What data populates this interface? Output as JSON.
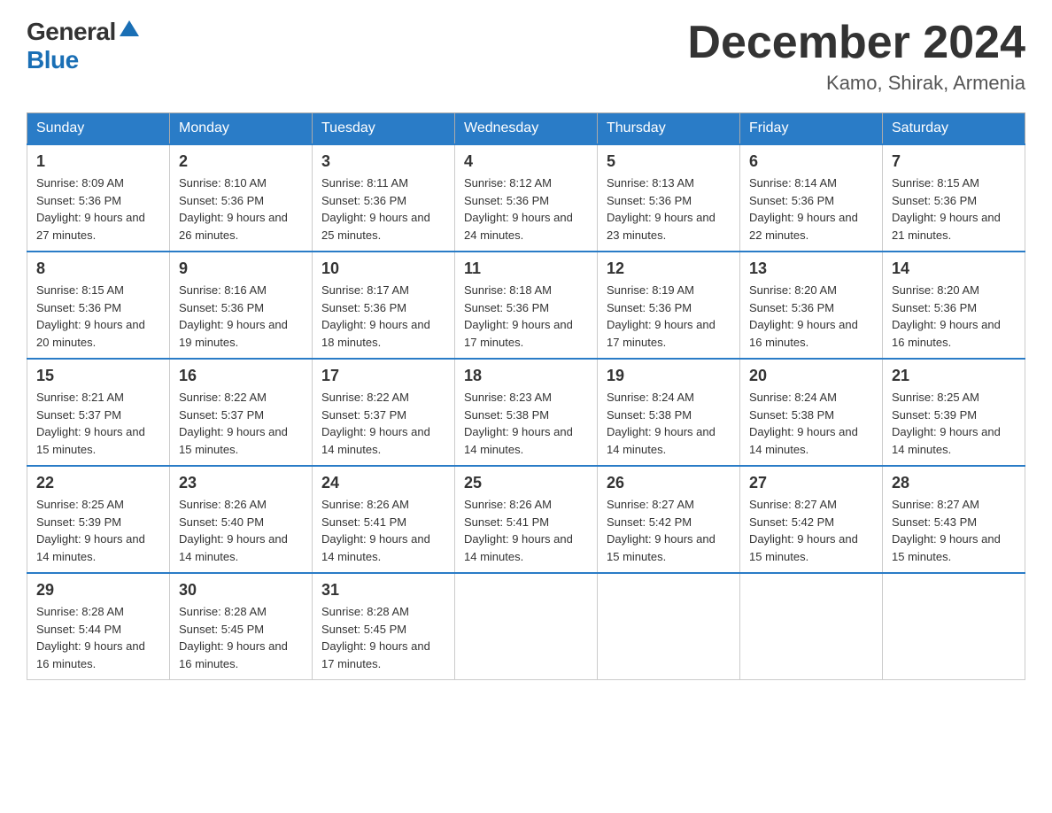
{
  "header": {
    "logo_general": "General",
    "logo_blue": "Blue",
    "month_title": "December 2024",
    "location": "Kamo, Shirak, Armenia"
  },
  "calendar": {
    "days_of_week": [
      "Sunday",
      "Monday",
      "Tuesday",
      "Wednesday",
      "Thursday",
      "Friday",
      "Saturday"
    ],
    "weeks": [
      [
        {
          "day": "1",
          "sunrise": "8:09 AM",
          "sunset": "5:36 PM",
          "daylight": "9 hours and 27 minutes."
        },
        {
          "day": "2",
          "sunrise": "8:10 AM",
          "sunset": "5:36 PM",
          "daylight": "9 hours and 26 minutes."
        },
        {
          "day": "3",
          "sunrise": "8:11 AM",
          "sunset": "5:36 PM",
          "daylight": "9 hours and 25 minutes."
        },
        {
          "day": "4",
          "sunrise": "8:12 AM",
          "sunset": "5:36 PM",
          "daylight": "9 hours and 24 minutes."
        },
        {
          "day": "5",
          "sunrise": "8:13 AM",
          "sunset": "5:36 PM",
          "daylight": "9 hours and 23 minutes."
        },
        {
          "day": "6",
          "sunrise": "8:14 AM",
          "sunset": "5:36 PM",
          "daylight": "9 hours and 22 minutes."
        },
        {
          "day": "7",
          "sunrise": "8:15 AM",
          "sunset": "5:36 PM",
          "daylight": "9 hours and 21 minutes."
        }
      ],
      [
        {
          "day": "8",
          "sunrise": "8:15 AM",
          "sunset": "5:36 PM",
          "daylight": "9 hours and 20 minutes."
        },
        {
          "day": "9",
          "sunrise": "8:16 AM",
          "sunset": "5:36 PM",
          "daylight": "9 hours and 19 minutes."
        },
        {
          "day": "10",
          "sunrise": "8:17 AM",
          "sunset": "5:36 PM",
          "daylight": "9 hours and 18 minutes."
        },
        {
          "day": "11",
          "sunrise": "8:18 AM",
          "sunset": "5:36 PM",
          "daylight": "9 hours and 17 minutes."
        },
        {
          "day": "12",
          "sunrise": "8:19 AM",
          "sunset": "5:36 PM",
          "daylight": "9 hours and 17 minutes."
        },
        {
          "day": "13",
          "sunrise": "8:20 AM",
          "sunset": "5:36 PM",
          "daylight": "9 hours and 16 minutes."
        },
        {
          "day": "14",
          "sunrise": "8:20 AM",
          "sunset": "5:36 PM",
          "daylight": "9 hours and 16 minutes."
        }
      ],
      [
        {
          "day": "15",
          "sunrise": "8:21 AM",
          "sunset": "5:37 PM",
          "daylight": "9 hours and 15 minutes."
        },
        {
          "day": "16",
          "sunrise": "8:22 AM",
          "sunset": "5:37 PM",
          "daylight": "9 hours and 15 minutes."
        },
        {
          "day": "17",
          "sunrise": "8:22 AM",
          "sunset": "5:37 PM",
          "daylight": "9 hours and 14 minutes."
        },
        {
          "day": "18",
          "sunrise": "8:23 AM",
          "sunset": "5:38 PM",
          "daylight": "9 hours and 14 minutes."
        },
        {
          "day": "19",
          "sunrise": "8:24 AM",
          "sunset": "5:38 PM",
          "daylight": "9 hours and 14 minutes."
        },
        {
          "day": "20",
          "sunrise": "8:24 AM",
          "sunset": "5:38 PM",
          "daylight": "9 hours and 14 minutes."
        },
        {
          "day": "21",
          "sunrise": "8:25 AM",
          "sunset": "5:39 PM",
          "daylight": "9 hours and 14 minutes."
        }
      ],
      [
        {
          "day": "22",
          "sunrise": "8:25 AM",
          "sunset": "5:39 PM",
          "daylight": "9 hours and 14 minutes."
        },
        {
          "day": "23",
          "sunrise": "8:26 AM",
          "sunset": "5:40 PM",
          "daylight": "9 hours and 14 minutes."
        },
        {
          "day": "24",
          "sunrise": "8:26 AM",
          "sunset": "5:41 PM",
          "daylight": "9 hours and 14 minutes."
        },
        {
          "day": "25",
          "sunrise": "8:26 AM",
          "sunset": "5:41 PM",
          "daylight": "9 hours and 14 minutes."
        },
        {
          "day": "26",
          "sunrise": "8:27 AM",
          "sunset": "5:42 PM",
          "daylight": "9 hours and 15 minutes."
        },
        {
          "day": "27",
          "sunrise": "8:27 AM",
          "sunset": "5:42 PM",
          "daylight": "9 hours and 15 minutes."
        },
        {
          "day": "28",
          "sunrise": "8:27 AM",
          "sunset": "5:43 PM",
          "daylight": "9 hours and 15 minutes."
        }
      ],
      [
        {
          "day": "29",
          "sunrise": "8:28 AM",
          "sunset": "5:44 PM",
          "daylight": "9 hours and 16 minutes."
        },
        {
          "day": "30",
          "sunrise": "8:28 AM",
          "sunset": "5:45 PM",
          "daylight": "9 hours and 16 minutes."
        },
        {
          "day": "31",
          "sunrise": "8:28 AM",
          "sunset": "5:45 PM",
          "daylight": "9 hours and 17 minutes."
        },
        null,
        null,
        null,
        null
      ]
    ]
  }
}
